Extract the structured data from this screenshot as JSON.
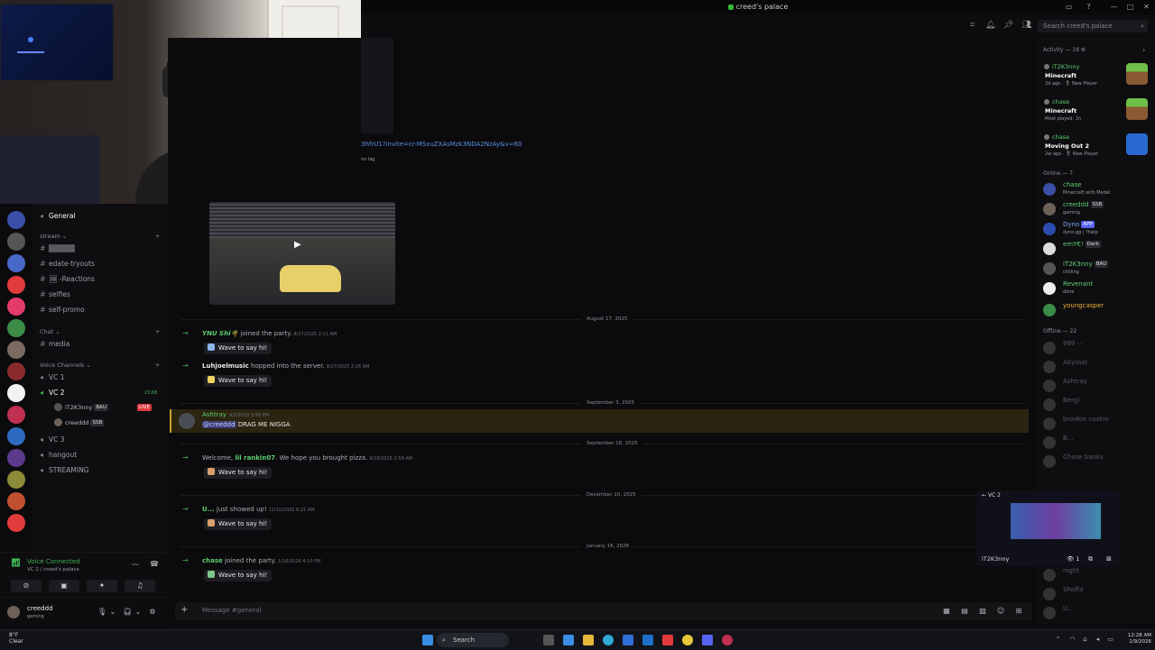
{
  "window": {
    "title": "creed's palace"
  },
  "header": {
    "search_placeholder": "Search creed's palace"
  },
  "channels": {
    "general": "General",
    "cat_stream": "stream",
    "stream_items": [
      "▒▒▒▒▒",
      "edate-tryouts",
      "🖼 -Reactions",
      "selfies",
      "self-promo"
    ],
    "cat_chat": "Chat",
    "media": "media",
    "cat_voice": "Voice Channels",
    "voice": [
      "VC 1",
      "VC 2",
      "VC 3",
      "hangout",
      "STREAMING"
    ],
    "vc2_time": "23:68",
    "vc2_users": [
      {
        "name": "iT2K3nny",
        "tag": "BAU",
        "live": "LIVE"
      },
      {
        "name": "creeddd",
        "tag": "SSB"
      }
    ]
  },
  "voice_panel": {
    "status": "Voice Connected",
    "sub": "VC 2 / creed's palace"
  },
  "user_panel": {
    "name": "creeddd",
    "status": "gaming"
  },
  "chat": {
    "invite": "3hfrU1?invite=cr-MSxuZXAsMzk3NDA2NzAy&v=60",
    "embed_small": "no lag",
    "dividers": [
      "August 17, 2025",
      "September 3, 2025",
      "September 18, 2025",
      "December 10, 2025",
      "January 16, 2026"
    ],
    "wave_label": "Wave to say hi!",
    "m1": {
      "name": "YNU Shi🌴",
      "text": "joined the party.",
      "time": "8/17/2025 2:11 AM"
    },
    "m2": {
      "name": "Luhjoelmusic",
      "text": "hopped into the server.",
      "time": "8/17/2025 2:26 AM"
    },
    "m3": {
      "name": "Ashtray",
      "time": "9/3/2025 3:50 PM",
      "mention": "@creeddd",
      "text": "DRAG ME NIGGA"
    },
    "m4": {
      "prefix": "Welcome,",
      "name": "lil rankin07",
      "text": ". We hope you brought pizza.",
      "time": "9/18/2025 2:59 AM"
    },
    "m5": {
      "name": "U...",
      "text": "just showed up!",
      "time": "12/10/2025 6:21 AM"
    },
    "m6": {
      "name": "chase",
      "text": "joined the party.",
      "time": "1/16/2026 4:10 PM"
    }
  },
  "composer": {
    "placeholder": "Message #general"
  },
  "members": {
    "activity_title": "Activity — 18 ⚙",
    "activity": [
      {
        "user": "iT2K3nny",
        "game": "Minecraft",
        "sub": "2d ago · 🎖 New Player"
      },
      {
        "user": "chase",
        "game": "Minecraft",
        "sub": "Most played: 1h"
      },
      {
        "user": "chase",
        "game": "Moving Out 2",
        "sub": "2w ago · 🎖 New Player"
      }
    ],
    "online_title": "Online — 7",
    "online": [
      {
        "name": "chase",
        "status": "Minecraft with Medal",
        "color": "#5fce70"
      },
      {
        "name": "creeddd",
        "badge": "SSB",
        "status": "gaming",
        "color": "#5fce70"
      },
      {
        "name": "Dyno",
        "badge": "APP",
        "status": "dyno.gg | ?help",
        "color": "#5f8cf0"
      },
      {
        "name": "emY€!",
        "badge": "Dark",
        "status": "",
        "color": "#5fce70"
      },
      {
        "name": "iT2K3nny",
        "badge": "BAU",
        "status": "chilling",
        "color": "#5fce70"
      },
      {
        "name": "Revenant",
        "status": "done",
        "color": "#5fce70"
      },
      {
        "name": "youngcasper",
        "status": "",
        "color": "#f0b132"
      }
    ],
    "offline_title": "Offline — 22",
    "offline": [
      "999 ⋯",
      "Abyssal",
      "Ashtray",
      "Bergi",
      "brookie cookie",
      "B...",
      "Chase banks"
    ],
    "offline_tail": [
      "night",
      "Shoffa",
      "U..."
    ]
  },
  "overlay": {
    "label": "iT2K3nny",
    "vc": "VC 2",
    "count": "1"
  },
  "taskbar": {
    "weather_temp": "8°F",
    "weather_desc": "Clear",
    "search": "Search",
    "time": "12:28 AM",
    "date": "1/9/2026"
  }
}
